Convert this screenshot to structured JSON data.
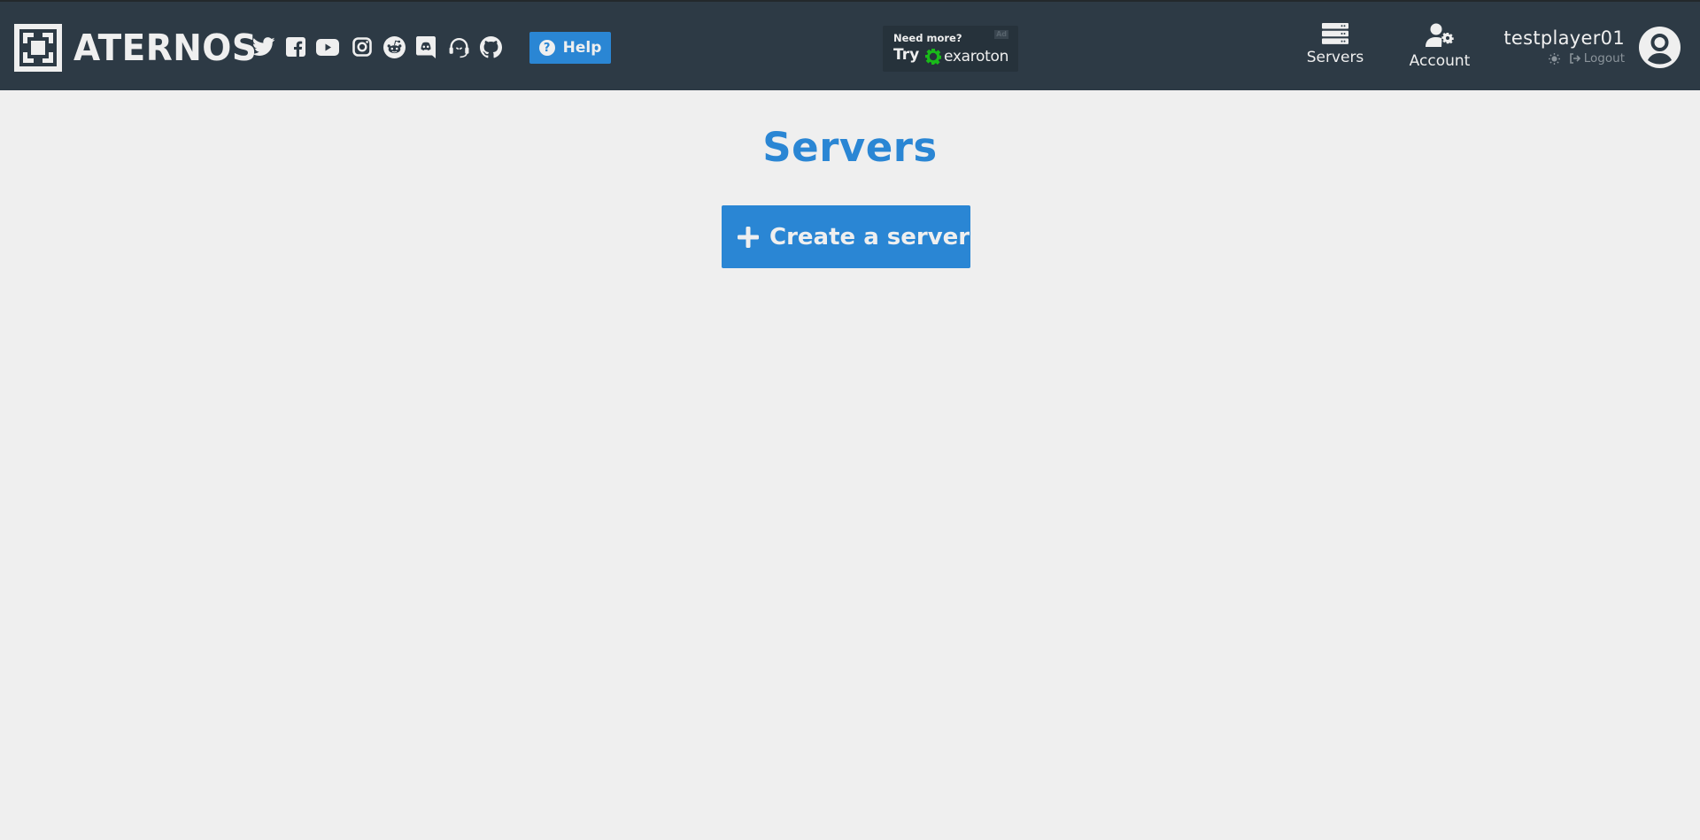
{
  "header": {
    "brand": "ATERNOS",
    "social_icons": [
      {
        "name": "twitter-icon"
      },
      {
        "name": "facebook-icon"
      },
      {
        "name": "youtube-icon"
      },
      {
        "name": "instagram-icon"
      },
      {
        "name": "reddit-icon"
      },
      {
        "name": "discord-icon"
      },
      {
        "name": "support-headset-icon"
      },
      {
        "name": "github-icon"
      }
    ],
    "help_label": "Help",
    "ad": {
      "line1": "Need more?",
      "try_label": "Try",
      "brand": "exaroton",
      "badge": "Ad"
    },
    "nav": [
      {
        "label": "Servers",
        "icon": "servers-icon"
      },
      {
        "label": "Account",
        "icon": "account-settings-icon"
      }
    ],
    "user": {
      "username": "testplayer01",
      "logout_label": "Logout"
    }
  },
  "main": {
    "title": "Servers",
    "create_button_label": "Create a server"
  },
  "colors": {
    "header_bg": "#2d3a45",
    "page_bg": "#efefef",
    "accent": "#2a86d4",
    "exaroton_green": "#19ba19"
  }
}
